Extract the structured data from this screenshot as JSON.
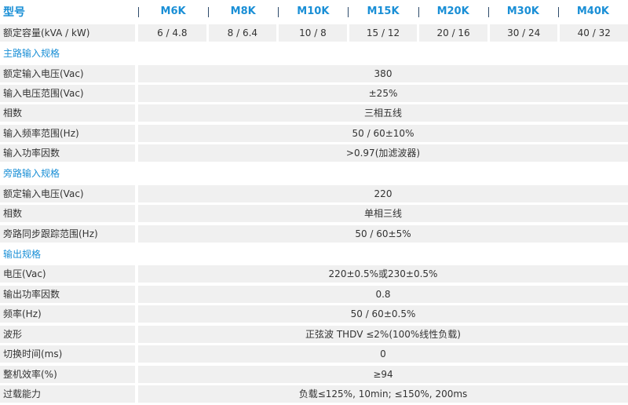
{
  "header": {
    "label": "型号",
    "models": [
      "M6K",
      "M8K",
      "M10K",
      "M15K",
      "M20K",
      "M30K",
      "M40K"
    ]
  },
  "capacity": {
    "label": "额定容量(kVA / kW)",
    "values": [
      "6 / 4.8",
      "8 / 6.4",
      "10 / 8",
      "15 / 12",
      "20 / 16",
      "30 / 24",
      "40 / 32"
    ]
  },
  "sections": [
    {
      "title": "主路输入规格",
      "rows": [
        {
          "label": "额定输入电压(Vac)",
          "value": "380"
        },
        {
          "label": "输入电压范围(Vac)",
          "value": "±25%"
        },
        {
          "label": "相数",
          "value": "三相五线"
        },
        {
          "label": "输入频率范围(Hz)",
          "value": "50 / 60±10%"
        },
        {
          "label": "输入功率因数",
          "value": ">0.97(加滤波器)"
        }
      ]
    },
    {
      "title": "旁路输入规格",
      "rows": [
        {
          "label": "额定输入电压(Vac)",
          "value": "220"
        },
        {
          "label": "相数",
          "value": "单相三线"
        },
        {
          "label": "旁路同步跟踪范围(Hz)",
          "value": "50 / 60±5%"
        }
      ]
    },
    {
      "title": "输出规格",
      "rows": [
        {
          "label": "电压(Vac)",
          "value": "220±0.5%或230±0.5%"
        },
        {
          "label": "输出功率因数",
          "value": "0.8"
        },
        {
          "label": "频率(Hz)",
          "value": "50 / 60±0.5%"
        },
        {
          "label": "波形",
          "value": "正弦波 THDV ≤2%(100%线性负载)"
        },
        {
          "label": "切换时间(ms)",
          "value": "0"
        },
        {
          "label": "整机效率(%)",
          "value": "≥94"
        },
        {
          "label": "过载能力",
          "value": "负载≤125%, 10min; ≤150%, 200ms"
        }
      ]
    }
  ],
  "colors": {
    "accent": "#1a8fd6",
    "row_bg": "#f0f0f0",
    "divider": "#2d4a6a"
  }
}
